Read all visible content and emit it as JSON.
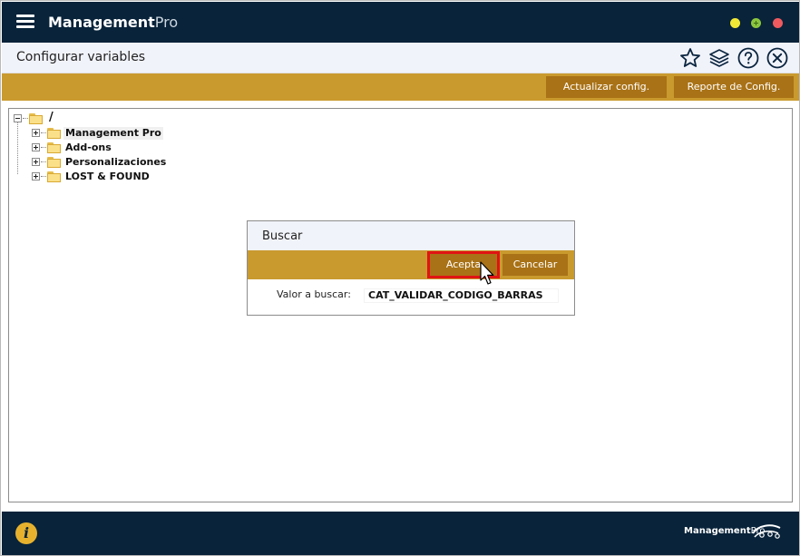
{
  "app": {
    "title_bold": "Management",
    "title_light": "Pro"
  },
  "window_controls": {
    "minimize_color": "#f2e936",
    "maximize_color": "#8cc63e",
    "close_color": "#ef5a5f"
  },
  "header": {
    "page_title": "Configurar variables",
    "icons": [
      "star-icon",
      "layers-icon",
      "help-icon",
      "close-circle-icon"
    ]
  },
  "toolbar": {
    "update_label": "Actualizar config.",
    "report_label": "Reporte de Config."
  },
  "tree": {
    "root_label": "/",
    "items": [
      {
        "label": "Management Pro",
        "selected": true
      },
      {
        "label": "Add-ons",
        "selected": false
      },
      {
        "label": "Personalizaciones",
        "selected": false
      },
      {
        "label": "LOST & FOUND",
        "selected": false
      }
    ]
  },
  "dialog": {
    "title": "Buscar",
    "accept_label": "Acepta",
    "cancel_label": "Cancelar",
    "search_label": "Valor a buscar:",
    "search_value": "CAT_VALIDAR_CODIGO_BARRAS"
  },
  "footer": {
    "brand_bold": "Management",
    "brand_light": "Pro",
    "info_icon": "info-icon"
  },
  "colors": {
    "titlebar": "#08233a",
    "accent": "#c99a2e",
    "button": "#a97216",
    "highlight": "#e01414"
  }
}
